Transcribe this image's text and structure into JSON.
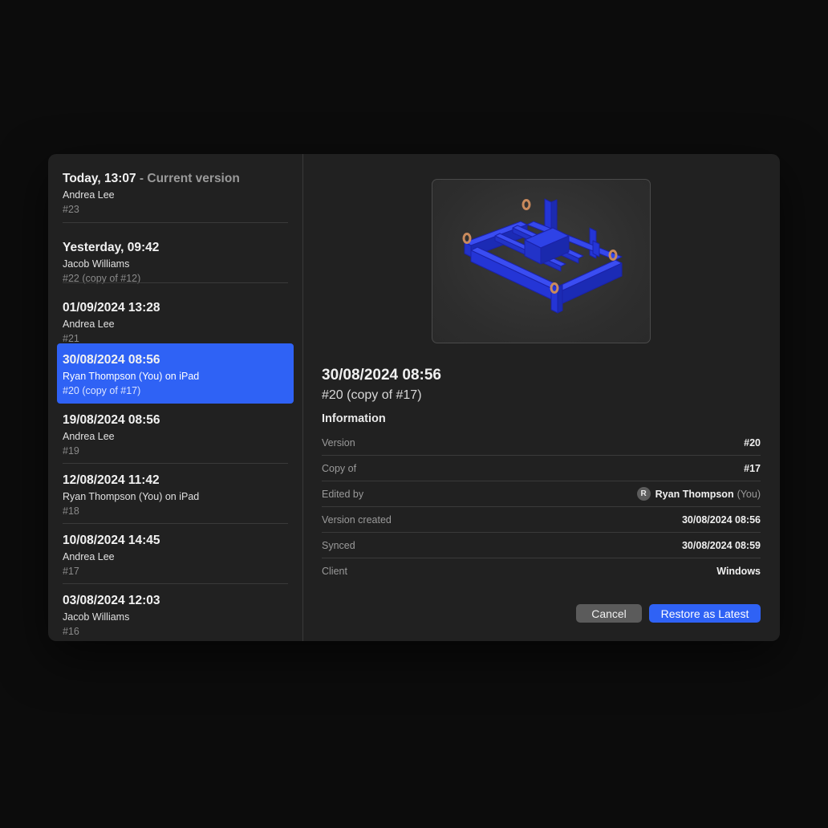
{
  "versions": [
    {
      "title": "Today, 13:07",
      "suffix": " - Current version",
      "author": "Andrea Lee",
      "num": "#23"
    },
    {
      "title": "Yesterday, 09:42",
      "author": "Jacob Williams",
      "num": "#22 (copy of #12)"
    },
    {
      "title": "01/09/2024 13:28",
      "author": "Andrea Lee",
      "num": "#21"
    },
    {
      "title": "30/08/2024 08:56",
      "author": "Ryan Thompson (You) on iPad",
      "num": "#20 (copy of #17)"
    },
    {
      "title": "19/08/2024 08:56",
      "author": "Andrea Lee",
      "num": "#19"
    },
    {
      "title": "12/08/2024 11:42",
      "author": "Ryan Thompson (You) on iPad",
      "num": "#18"
    },
    {
      "title": "10/08/2024 14:45",
      "author": "Andrea Lee",
      "num": "#17"
    },
    {
      "title": "03/08/2024 12:03",
      "author": "Jacob Williams",
      "num": "#16"
    }
  ],
  "detail": {
    "title": "30/08/2024 08:56",
    "subtitle": "#20 (copy of #17)",
    "info_heading": "Information",
    "rows": [
      {
        "label": "Version",
        "value": "#20"
      },
      {
        "label": "Copy of",
        "value": "#17"
      },
      {
        "label": "Edited by",
        "avatar": "R",
        "value": "Ryan Thompson",
        "suffix": "(You)"
      },
      {
        "label": "Version created",
        "value": "30/08/2024 08:56"
      },
      {
        "label": "Synced",
        "value": "30/08/2024 08:59"
      },
      {
        "label": "Client",
        "value": "Windows"
      }
    ]
  },
  "buttons": {
    "cancel": "Cancel",
    "restore": "Restore as Latest"
  },
  "colors": {
    "accent": "#2f62f5",
    "model": "#2a3fe0",
    "lifting_eye": "#c98a5c"
  },
  "preview": {
    "icon": "3d-model-thumbnail"
  }
}
